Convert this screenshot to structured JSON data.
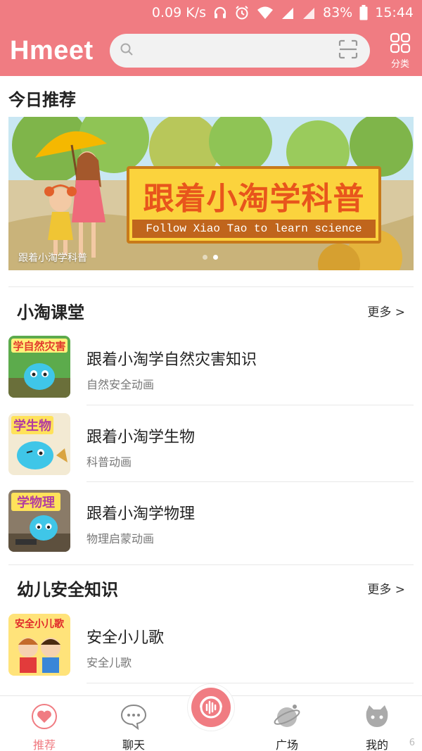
{
  "status_bar": {
    "speed": "0.09 K/s",
    "battery": "83%",
    "time": "15:44"
  },
  "header": {
    "logo": "Hmeet",
    "search_placeholder": "",
    "category_label": "分类"
  },
  "today": {
    "title": "今日推荐",
    "banner": {
      "title_cn": "跟着小淘学科普",
      "title_en": "Follow Xiao Tao to learn science",
      "caption": "跟着小淘学科普",
      "page": 2,
      "pages": 2
    }
  },
  "sections": [
    {
      "title": "小淘课堂",
      "more": "更多 >",
      "items": [
        {
          "title": "跟着小淘学自然灾害知识",
          "subtitle": "自然安全动画",
          "thumb_text": "学自然灾害"
        },
        {
          "title": "跟着小淘学生物",
          "subtitle": "科普动画",
          "thumb_text": "学生物"
        },
        {
          "title": "跟着小淘学物理",
          "subtitle": "物理启蒙动画",
          "thumb_text": "学物理"
        }
      ]
    },
    {
      "title": "幼儿安全知识",
      "more": "更多 >",
      "items": [
        {
          "title": "安全小儿歌",
          "subtitle": "安全儿歌",
          "thumb_text": "安全小儿歌"
        }
      ]
    }
  ],
  "tabs": [
    {
      "label": "推荐",
      "icon": "heart-icon",
      "active": true
    },
    {
      "label": "聊天",
      "icon": "chat-bubble-icon",
      "active": false
    },
    {
      "label": "",
      "icon": "audio-record-icon",
      "active": false
    },
    {
      "label": "广场",
      "icon": "planet-icon",
      "active": false
    },
    {
      "label": "我的",
      "icon": "cat-face-icon",
      "active": false
    }
  ],
  "colors": {
    "brand": "#f07c82",
    "banner_board": "#fbd33d",
    "banner_text": "#e8551c"
  },
  "watermark": "6"
}
